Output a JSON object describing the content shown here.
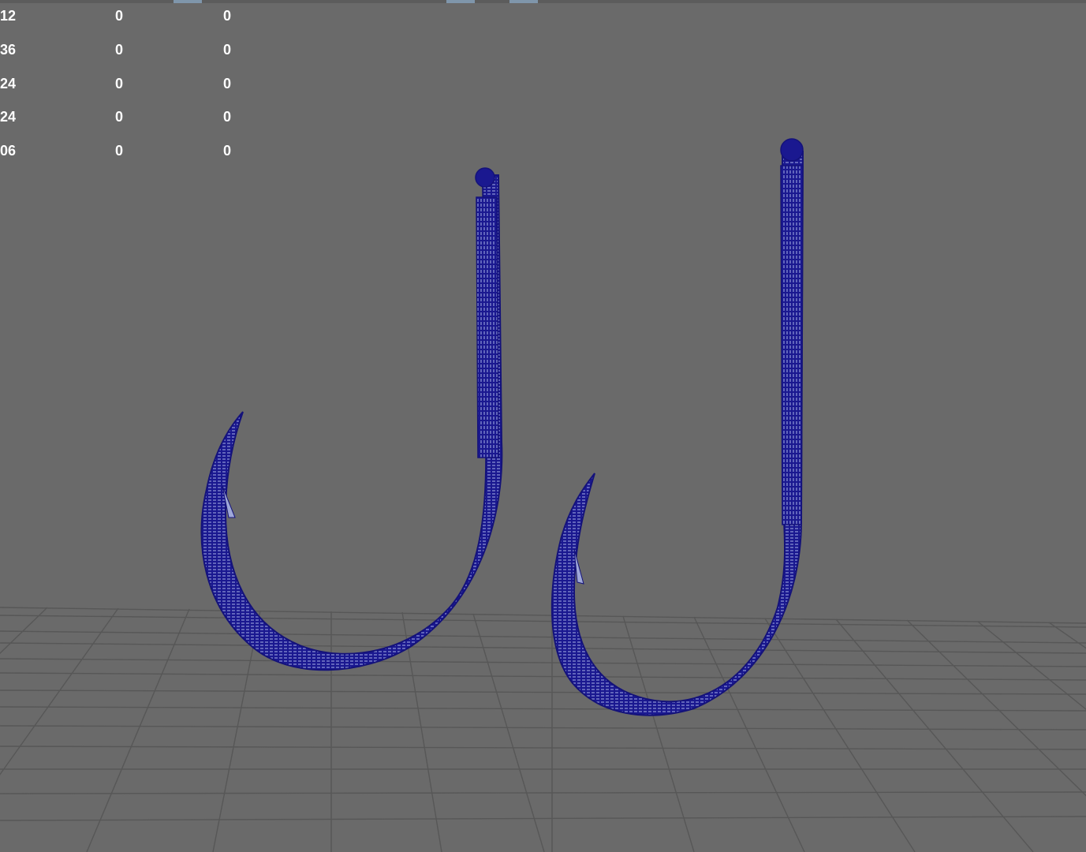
{
  "viewport": {
    "background": "#6a6a6a",
    "grid_color": "#5a5a5a",
    "wire_color": "#1a1890",
    "wire_highlight": "#c8d4ff"
  },
  "hud": {
    "rows": [
      [
        "12",
        "0",
        "0"
      ],
      [
        "36",
        "0",
        "0"
      ],
      [
        "24",
        "0",
        "0"
      ],
      [
        "24",
        "0",
        "0"
      ],
      [
        "06",
        "0",
        "0"
      ]
    ]
  },
  "objects": [
    {
      "name": "fish-hook-left",
      "type": "wireframe-mesh"
    },
    {
      "name": "fish-hook-right",
      "type": "wireframe-mesh"
    }
  ]
}
